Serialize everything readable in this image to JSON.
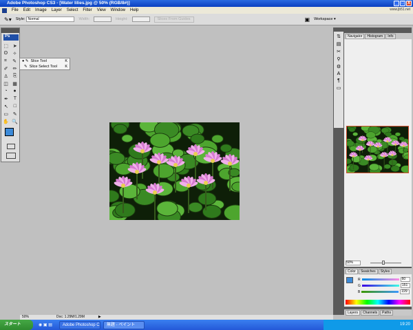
{
  "window": {
    "title": "Adobe Photoshop CS3 - [Water lilies.jpg @ 50% (RGB/8#)]",
    "buttons": [
      "_",
      "□",
      "X"
    ],
    "watermark": "www.jb51.net"
  },
  "menu": [
    "File",
    "Edit",
    "Image",
    "Layer",
    "Select",
    "Filter",
    "View",
    "Window",
    "Help"
  ],
  "options": {
    "style_label": "Style:",
    "style_value": "Normal",
    "width_label": "Width:",
    "height_label": "Height:",
    "guides_button": "Slices From Guides",
    "workspace": "Workspace ▾"
  },
  "toolbox": {
    "logo": "Ps",
    "rows": [
      [
        "⬚",
        "➤"
      ],
      [
        "ʘ",
        "✧"
      ],
      [
        "⌗",
        "✎"
      ],
      [
        "✐",
        "✏"
      ],
      [
        "♙",
        "⎘"
      ],
      [
        "◫",
        "▦"
      ],
      [
        "◔",
        "●"
      ],
      [
        "✒",
        "T"
      ],
      [
        "↖",
        "□"
      ],
      [
        "▭",
        "✎"
      ],
      [
        "✋",
        "🔍"
      ]
    ]
  },
  "flyout": {
    "items": [
      {
        "label": "Slice Tool",
        "key": "K",
        "selected": true
      },
      {
        "label": "Slice Select Tool",
        "key": "K",
        "selected": false
      }
    ]
  },
  "colors": {
    "foreground": "#3c8ad8",
    "background": "#ffffff"
  },
  "right_icons": [
    "⇅",
    "▤",
    "✂",
    "⚲",
    "⚙",
    "A",
    "¶",
    "▭"
  ],
  "navigator": {
    "tabs": [
      "Navigator",
      "Histogram",
      "Info"
    ],
    "zoom": "50%"
  },
  "color_panel": {
    "tabs": [
      "Color",
      "Swatches",
      "Styles"
    ],
    "channels": [
      {
        "label": "R",
        "value": "60"
      },
      {
        "label": "G",
        "value": "151"
      },
      {
        "label": "B",
        "value": "229"
      }
    ]
  },
  "layers_panel": {
    "tabs": [
      "Layers",
      "Channels",
      "Paths"
    ]
  },
  "status": {
    "zoom": "50%",
    "doc": "Doc: 1.29M/1.29M"
  },
  "taskbar": {
    "start": "スタート",
    "tasks": [
      "Adobe Photoshop CS...",
      "無題 - ペイント"
    ],
    "clock": "19:20"
  }
}
